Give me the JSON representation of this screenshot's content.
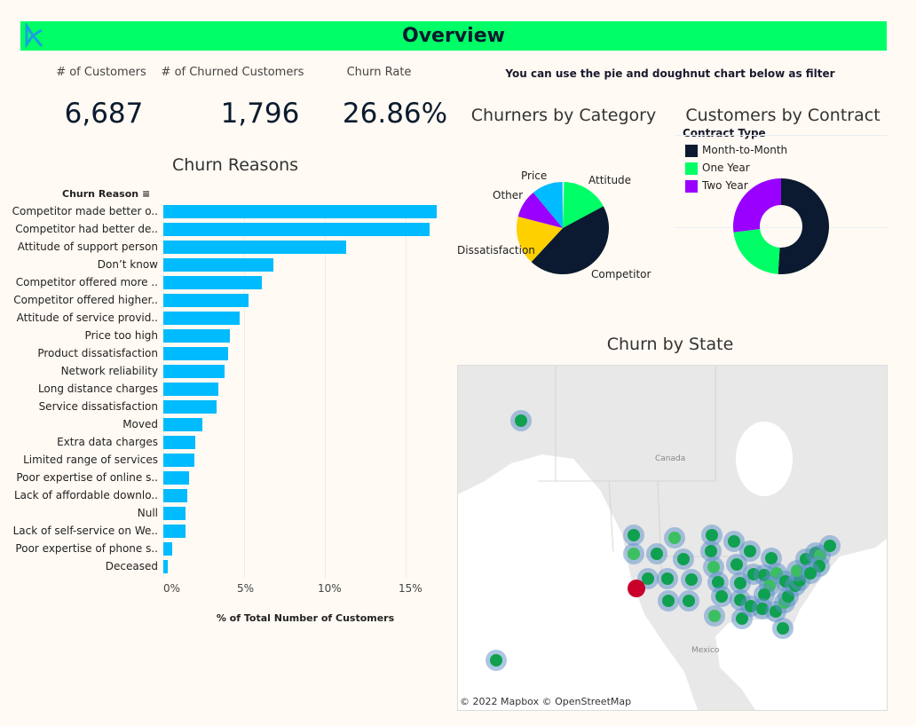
{
  "header": {
    "title": "Overview",
    "logo": "DC logo"
  },
  "kpis": [
    {
      "label": "# of Customers",
      "value": "6,687"
    },
    {
      "label": "# of Churned Customers",
      "value": "1,796"
    },
    {
      "label": "Churn Rate",
      "value": "26.86%"
    }
  ],
  "filter_note": "You can use the pie and doughnut chart below as filter",
  "chart_data": [
    {
      "type": "bar",
      "title": "Churn Reasons",
      "ylabel": "Churn Reason",
      "xlabel": "% of Total Number of Customers",
      "sort_icon": "sort-descending-icon",
      "xlim": [
        0,
        17.5
      ],
      "xticks": [
        "0%",
        "5%",
        "10%",
        "15%"
      ],
      "grid": true,
      "categories": [
        "Competitor made better o..",
        "Competitor had better de..",
        "Attitude of support person",
        "Don’t know",
        "Competitor offered more ..",
        "Competitor offered higher..",
        "Attitude of service provid..",
        "Price too high",
        "Product dissatisfaction",
        "Network reliability",
        "Long distance charges",
        "Service dissatisfaction",
        "Moved",
        "Extra data charges",
        "Limited range of services",
        "Poor expertise of online s..",
        "Lack of affordable downlo..",
        "Null",
        "Lack of self-service on We..",
        "Poor expertise of phone s..",
        "Deceased"
      ],
      "values": [
        16.9,
        16.5,
        11.3,
        6.8,
        6.1,
        5.3,
        4.7,
        4.1,
        4.0,
        3.8,
        3.4,
        3.3,
        2.4,
        2.0,
        1.9,
        1.6,
        1.5,
        1.4,
        1.4,
        0.55,
        0.3
      ],
      "color": "#00bbff"
    },
    {
      "type": "pie",
      "title": "Churners by Category",
      "categories": [
        "Attitude",
        "Competitor",
        "Dissatisfaction",
        "Other",
        "Price"
      ],
      "values": [
        16.8,
        45.0,
        17.2,
        10.0,
        11.0
      ],
      "colors": [
        "#00ff66",
        "#0b1a30",
        "#ffd000",
        "#9900ff",
        "#00bbff"
      ]
    },
    {
      "type": "pie",
      "subtype": "doughnut",
      "title": "Customers by Contract",
      "legend_title": "Contract Type",
      "legend_placement": "top-left",
      "categories": [
        "Month-to-Month",
        "One Year",
        "Two Year"
      ],
      "values": [
        51,
        22,
        27
      ],
      "colors": [
        "#0b1a30",
        "#00ff66",
        "#9900ff"
      ]
    }
  ],
  "map": {
    "title": "Churn by State",
    "labels": {
      "canada": "Canada",
      "mexico": "Mexico"
    },
    "attribution": "© 2022 Mapbox  © OpenStreetMap",
    "colors": {
      "marker": "#0fa050",
      "halo": "#5b8fc7",
      "highlight": "#c8002a"
    }
  }
}
